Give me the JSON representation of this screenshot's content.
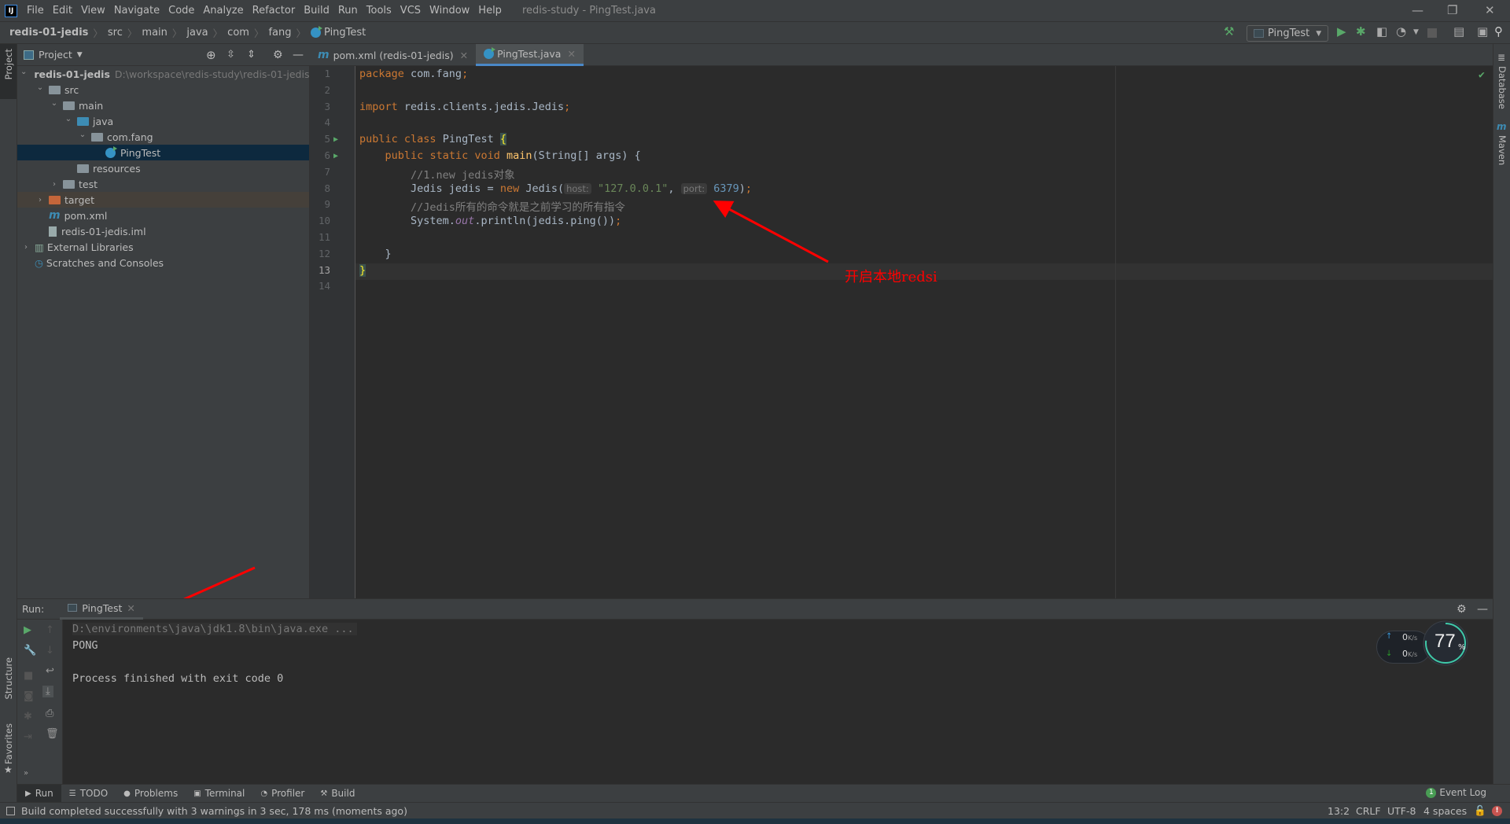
{
  "menubar": {
    "items": [
      "File",
      "Edit",
      "View",
      "Navigate",
      "Code",
      "Analyze",
      "Refactor",
      "Build",
      "Run",
      "Tools",
      "VCS",
      "Window",
      "Help"
    ],
    "title": "redis-study - PingTest.java",
    "logo": "IJ"
  },
  "breadcrumb": [
    "redis-01-jedis",
    "src",
    "main",
    "java",
    "com",
    "fang",
    "PingTest"
  ],
  "toolbar": {
    "run_config": "PingTest"
  },
  "left_strip": {
    "project": "Project",
    "structure": "Structure",
    "favorites": "Favorites"
  },
  "right_strip": {
    "database": "Database",
    "maven": "Maven"
  },
  "project": {
    "header": "Project",
    "tree": [
      {
        "label": "redis-01-jedis",
        "hint": "D:\\workspace\\redis-study\\redis-01-jedis",
        "depth": 0,
        "expanded": true,
        "icon": "module-icon"
      },
      {
        "label": "src",
        "depth": 1,
        "expanded": true,
        "icon": "folder-icon"
      },
      {
        "label": "main",
        "depth": 2,
        "expanded": true,
        "icon": "folder-icon"
      },
      {
        "label": "java",
        "depth": 3,
        "expanded": true,
        "icon": "source-folder-icon"
      },
      {
        "label": "com.fang",
        "depth": 4,
        "expanded": true,
        "icon": "package-icon"
      },
      {
        "label": "PingTest",
        "depth": 5,
        "selected": true,
        "icon": "class-icon"
      },
      {
        "label": "resources",
        "depth": 3,
        "icon": "resources-folder-icon"
      },
      {
        "label": "test",
        "depth": 2,
        "expanded": false,
        "icon": "folder-icon"
      },
      {
        "label": "target",
        "depth": 1,
        "expanded": false,
        "icon": "excluded-folder-icon"
      },
      {
        "label": "pom.xml",
        "depth": 1,
        "icon": "maven-icon"
      },
      {
        "label": "redis-01-jedis.iml",
        "depth": 1,
        "icon": "iml-file-icon"
      },
      {
        "label": "External Libraries",
        "depth": 0,
        "expanded": false,
        "icon": "library-icon"
      },
      {
        "label": "Scratches and Consoles",
        "depth": 0,
        "icon": "scratches-icon"
      }
    ]
  },
  "tabs": [
    {
      "label": "pom.xml (redis-01-jedis)",
      "active": false
    },
    {
      "label": "PingTest.java",
      "active": true
    }
  ],
  "editor": {
    "current_line": 13,
    "hints": {
      "host": "host:",
      "port": "port:"
    },
    "lines": [
      "package com.fang;",
      "",
      "import redis.clients.jedis.Jedis;",
      "",
      "public class PingTest {",
      "    public static void main(String[] args) {",
      "        //1.new jedis对象",
      "        Jedis jedis = new Jedis(\"127.0.0.1\", 6379);",
      "        //Jedis所有的命令就是之前学习的所有指令",
      "        System.out.println(jedis.ping());",
      "",
      "    }",
      "}",
      ""
    ]
  },
  "annotation": {
    "text": "开启本地redsi",
    "color": "#ff0000"
  },
  "run": {
    "label": "Run:",
    "tab": "PingTest",
    "output": [
      "D:\\environments\\java\\jdk1.8\\bin\\java.exe ...",
      "PONG",
      "",
      "Process finished with exit code 0"
    ]
  },
  "widget": {
    "up": "0",
    "down": "0",
    "unit": "K/s",
    "percent": "77",
    "percent_sign": "%",
    "fraction": 0.77
  },
  "bottom_tools": [
    "Run",
    "TODO",
    "Problems",
    "Terminal",
    "Profiler",
    "Build"
  ],
  "event_log": {
    "count": "1",
    "label": "Event Log"
  },
  "status": {
    "message": "Build completed successfully with 3 warnings in 3 sec, 178 ms (moments ago)",
    "position": "13:2",
    "line_sep": "CRLF",
    "encoding": "UTF-8",
    "indent": "4 spaces"
  }
}
